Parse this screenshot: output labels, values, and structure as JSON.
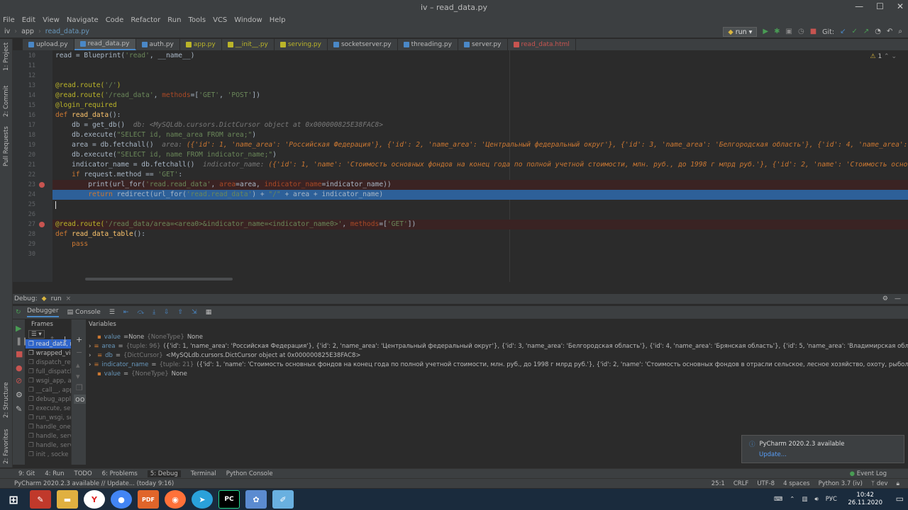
{
  "window": {
    "title": "iv – read_data.py"
  },
  "menu": [
    "File",
    "Edit",
    "View",
    "Navigate",
    "Code",
    "Refactor",
    "Run",
    "Tools",
    "VCS",
    "Window",
    "Help"
  ],
  "breadcrumb": [
    "iv",
    "app",
    "read_data.py"
  ],
  "run_config": "run",
  "git_label": "Git:",
  "tabs": [
    {
      "label": "upload.py",
      "color": "#4a88c7",
      "active": false
    },
    {
      "label": "read_data.py",
      "color": "#4a88c7",
      "active": true
    },
    {
      "label": "auth.py",
      "color": "#4a88c7",
      "active": false
    },
    {
      "label": "app.py",
      "color": "#bbb529",
      "active": false
    },
    {
      "label": "__init__.py",
      "color": "#bbb529",
      "active": false
    },
    {
      "label": "serving.py",
      "color": "#bbb529",
      "active": false
    },
    {
      "label": "socketserver.py",
      "color": "#4a88c7",
      "active": false
    },
    {
      "label": "threading.py",
      "color": "#4a88c7",
      "active": false
    },
    {
      "label": "server.py",
      "color": "#4a88c7",
      "active": false
    },
    {
      "label": "read_data.html",
      "color": "#c75450",
      "active": false
    }
  ],
  "left_panels": [
    "1: Project",
    "2: Commit",
    "Pull Requests"
  ],
  "left_panels_bottom": [
    "2: Structure",
    "2: Favorites"
  ],
  "inspection": "1",
  "code_lines": [
    {
      "n": "10",
      "html": "read = Blueprint(<span class=\"str\">'read'</span>, __name__)"
    },
    {
      "n": "11",
      "html": ""
    },
    {
      "n": "12",
      "html": ""
    },
    {
      "n": "13",
      "html": "<span class=\"dec\">@read.route(</span><span class=\"str\">'/'</span><span class=\"dec\">)</span>"
    },
    {
      "n": "14",
      "html": "<span class=\"dec\">@read.route(</span><span class=\"str\">'/read_data'</span>, <span class=\"par\">methods</span>=[<span class=\"str\">'GET'</span>, <span class=\"str\">'POST'</span>])"
    },
    {
      "n": "15",
      "html": "<span class=\"dec\">@login_required</span>"
    },
    {
      "n": "16",
      "html": "<span class=\"kw\">def</span> <span class=\"fn\">read_data</span>():"
    },
    {
      "n": "17",
      "html": "    db = get_db()  <span class=\"hint\">db: &lt;MySQLdb.cursors.DictCursor object at 0x000000825E38FAC8&gt;</span>"
    },
    {
      "n": "18",
      "html": "    db.execute(<span class=\"str\">\"SELECT id, name_area FROM area;\"</span>)"
    },
    {
      "n": "19",
      "html": "    area = db.fetchall()  <span class=\"hint\">area: </span><span class=\"hintv\">({'id': 1, 'name_area': 'Российская Федерация'}, {'id': 2, 'name_area': 'Центральный федеральный округ'}, {'id': 3, 'name_area': 'Белгородская область'}, {'id': 4, 'name_area': 'Брянская облас</span>"
    },
    {
      "n": "20",
      "html": "    db.execute(<span class=\"str\">\"SELECT id, name FROM indicator_name;\"</span>)"
    },
    {
      "n": "21",
      "html": "    indicator_name = db.fetchall()  <span class=\"hint\">indicator_name: </span><span class=\"hintv\">({'id': 1, 'name': 'Стоимость основных фондов на конец года по полной учетной стоимости, млн. руб., до 1998 г млрд руб.'}, {'id': 2, 'name': 'Стоимость основных фондов в отр</span>"
    },
    {
      "n": "22",
      "html": "    <span class=\"kw\">if</span> request.method == <span class=\"str\">'GET'</span>:"
    },
    {
      "n": "23",
      "html": "        print(url_for(<span class=\"str\">'read.read_data'</span>, <span class=\"par\">area</span>=area, <span class=\"par\">indicator_name</span>=indicator_name))"
    },
    {
      "n": "24",
      "html": "        <span class=\"kw\">return</span> redirect(url_for(<span class=\"str\">'read.read_data'</span>) + <span class=\"str\">\"/\"</span> + area + indicator_name)"
    },
    {
      "n": "25",
      "html": ""
    },
    {
      "n": "26",
      "html": ""
    },
    {
      "n": "27",
      "html": "<span class=\"dec\">@read.route(</span><span class=\"str\">'/read_data/area=&lt;area0&gt;&amp;indicator_name=&lt;indicator_name0&gt;'</span>, <span class=\"par\">methods</span>=[<span class=\"str\">'GET'</span>])"
    },
    {
      "n": "28",
      "html": "<span class=\"kw\">def</span> <span class=\"fn\">read_data_table</span>():"
    },
    {
      "n": "29",
      "html": "    <span class=\"kw\">pass</span>"
    },
    {
      "n": "30",
      "html": ""
    }
  ],
  "debug": {
    "label": "Debug:",
    "config": "run",
    "tabs": [
      "Debugger",
      "Console"
    ],
    "frames_header": "Frames",
    "variables_header": "Variables",
    "frames": [
      "read_data, rea",
      "wrapped_view",
      "dispatch_requ",
      "full_dispatch",
      "wsgi_app, app",
      "__call__, app",
      "debug_applic",
      "execute, serv",
      "run_wsgi, serv",
      "handle_one_re",
      "handle, serve",
      "handle, servin",
      "init , socke"
    ],
    "variables": [
      {
        "expand": "",
        "name": "value",
        "eq": "=None",
        "type": "{NoneType}",
        "val": "None"
      },
      {
        "expand": "›",
        "name": "area",
        "eq": "=",
        "type": "{tuple: 96}",
        "val": "({'id': 1, 'name_area': 'Российская Федерация'}, {'id': 2, 'name_area': 'Центральный федеральный округ'}, {'id': 3, 'name_area': 'Белгородская область'}, {'id': 4, 'name_area': 'Брянская область'}, {'id': 5, 'name_area': 'Владимирская область'}, {'id': 6, 'name_area': 'Воронежская область'}, {'id': 7,... View"
      },
      {
        "expand": "›",
        "name": "db",
        "eq": "=",
        "type": "{DictCursor}",
        "val": "<MySQLdb.cursors.DictCursor object at 0x000000825E38FAC8>"
      },
      {
        "expand": "›",
        "name": "indicator_name",
        "eq": "=",
        "type": "{tuple: 21}",
        "val": "({'id': 1, 'name': 'Стоимость основных фондов на конец года по полной учетной стоимости, млн. руб., до 1998 г млрд руб.'}, {'id': 2, 'name': 'Стоимость основных фондов в отрасли сельское, лесное хозяйство, охоту, рыболовство и рыбоводство, млн. руб.'}, {'id': 3, 'name': '(... View"
      },
      {
        "expand": "",
        "name": "value",
        "eq": "=",
        "type": "{NoneType}",
        "val": "None"
      }
    ]
  },
  "bottom_tools": [
    "9: Git",
    "4: Run",
    "TODO",
    "6: Problems",
    "5: Debug",
    "Terminal",
    "Python Console"
  ],
  "event_log": "Event Log",
  "status": {
    "message": "PyCharm 2020.2.3 available // Update... (today 9:16)",
    "position": "25:1",
    "line_sep": "CRLF",
    "encoding": "UTF-8",
    "indent": "4 spaces",
    "interpreter": "Python 3.7 (iv)",
    "branch": "dev"
  },
  "notification": {
    "title": "PyCharm 2020.2.3 available",
    "link": "Update..."
  },
  "taskbar": {
    "time": "10:42",
    "date": "26.11.2020",
    "lang": "РУС"
  }
}
